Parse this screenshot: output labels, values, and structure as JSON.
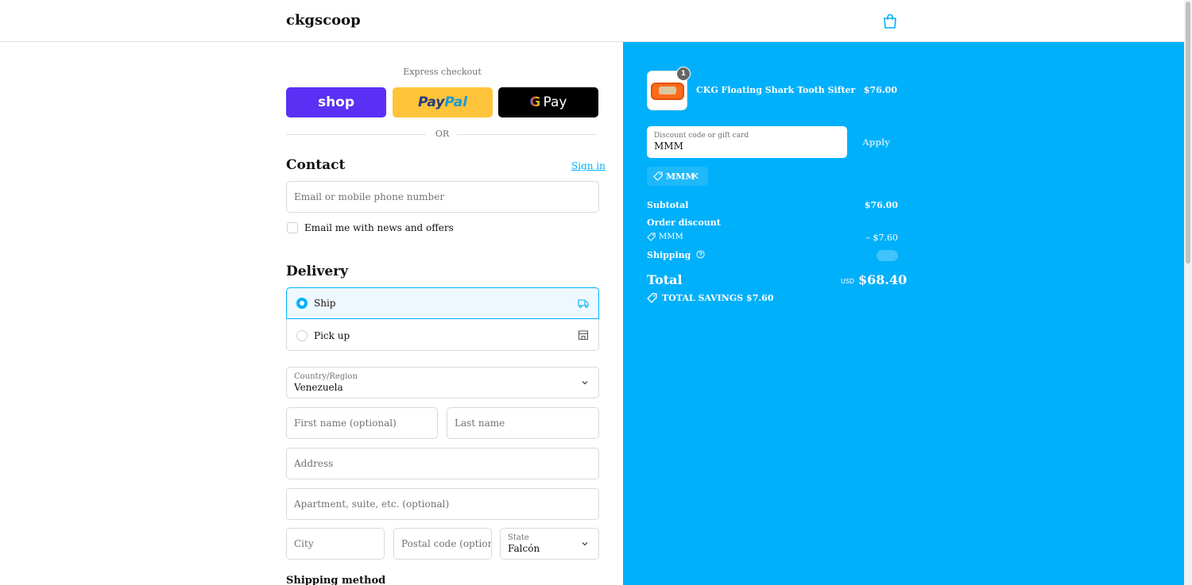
{
  "header": {
    "store_name": "ckgscoop"
  },
  "express": {
    "title": "Express checkout",
    "shop_label": "shop",
    "paypal_label_a": "Pay",
    "paypal_label_b": "Pal",
    "gpay_label_g": "G",
    "gpay_label": "Pay",
    "or_label": "OR"
  },
  "contact": {
    "title": "Contact",
    "sign_in": "Sign in",
    "email_placeholder": "Email or mobile phone number",
    "news_label": "Email me with news and offers"
  },
  "delivery": {
    "title": "Delivery",
    "options": [
      {
        "label": "Ship",
        "selected": true,
        "icon": "truck-icon"
      },
      {
        "label": "Pick up",
        "selected": false,
        "icon": "store-icon"
      }
    ],
    "country_label": "Country/Region",
    "country_value": "Venezuela",
    "first_name_placeholder": "First name (optional)",
    "last_name_placeholder": "Last name",
    "address_placeholder": "Address",
    "apartment_placeholder": "Apartment, suite, etc. (optional)",
    "city_placeholder": "City",
    "postal_placeholder": "Postal code (option...",
    "state_label": "State",
    "state_value": "Falcón",
    "shipping_method_title": "Shipping method"
  },
  "summary": {
    "item": {
      "name": "CKG Floating Shark Tooth Sifter",
      "price": "$76.00",
      "quantity": "1"
    },
    "discount_label": "Discount code or gift card",
    "discount_value": "MMM",
    "apply_label": "Apply",
    "applied_code": "MMM",
    "subtotal_label": "Subtotal",
    "subtotal_value": "$76.00",
    "order_discount_label": "Order discount",
    "order_discount_code": "MMM",
    "order_discount_value": "– $7.60",
    "shipping_label": "Shipping",
    "total_label": "Total",
    "currency": "USD",
    "total_value": "$68.40",
    "savings_label": "TOTAL SAVINGS",
    "savings_value": "$7.60"
  },
  "colors": {
    "accent": "#00b0fa",
    "shop": "#5a31f4",
    "paypal": "#ffc439",
    "gpay": "#000000"
  }
}
